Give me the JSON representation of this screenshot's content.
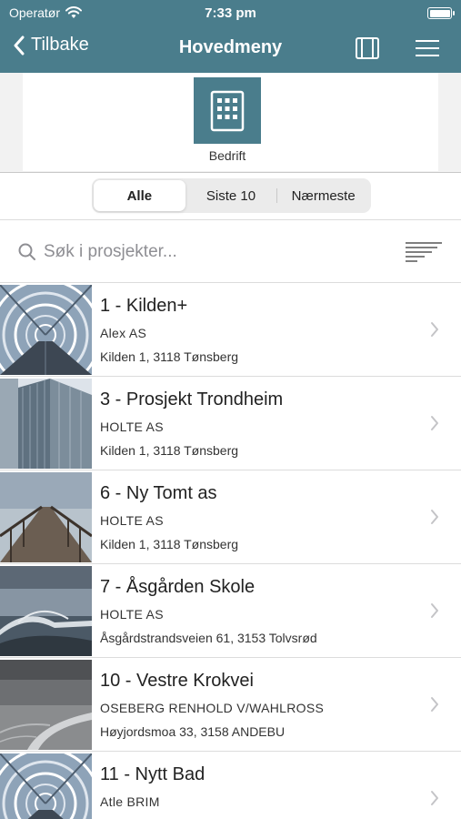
{
  "status_bar": {
    "carrier": "Operatør",
    "time": "7:33 pm",
    "battery_level": 1.0
  },
  "nav": {
    "back_label": "Tilbake",
    "title": "Hovedmeny"
  },
  "main_menu": {
    "tile_label": "Bedrift"
  },
  "segments": {
    "all": "Alle",
    "last10": "Siste 10",
    "nearest": "Nærmeste",
    "selected": "Alle"
  },
  "search": {
    "placeholder": "Søk i prosjekter..."
  },
  "colors": {
    "accent": "#4a7d8c"
  },
  "projects": [
    {
      "name": "1 - Kilden+",
      "company": "Alex AS",
      "address": "Kilden 1, 3118 Tønsberg",
      "thumb": "tunnel-bridge"
    },
    {
      "name": "3 - Prosjekt Trondheim",
      "company": "HOLTE AS",
      "address": "Kilden 1, 3118 Tønsberg",
      "thumb": "glass-building"
    },
    {
      "name": "6 - Ny Tomt as",
      "company": "HOLTE AS",
      "address": "Kilden 1, 3118 Tønsberg",
      "thumb": "pier"
    },
    {
      "name": "7 - Åsgården Skole",
      "company": "HOLTE AS",
      "address": "Åsgårdstrandsveien 61, 3153 Tolvsrød",
      "thumb": "coastal-bridge"
    },
    {
      "name": "10 - Vestre Krokvei",
      "company": "OSEBERG RENHOLD V/WAHLROSS",
      "address": "Høyjordsmoa 33, 3158 ANDEBU",
      "thumb": "sea-wall"
    },
    {
      "name": "11 - Nytt Bad",
      "company": "Atle BRIM",
      "address": "",
      "thumb": "tunnel-bridge"
    }
  ]
}
